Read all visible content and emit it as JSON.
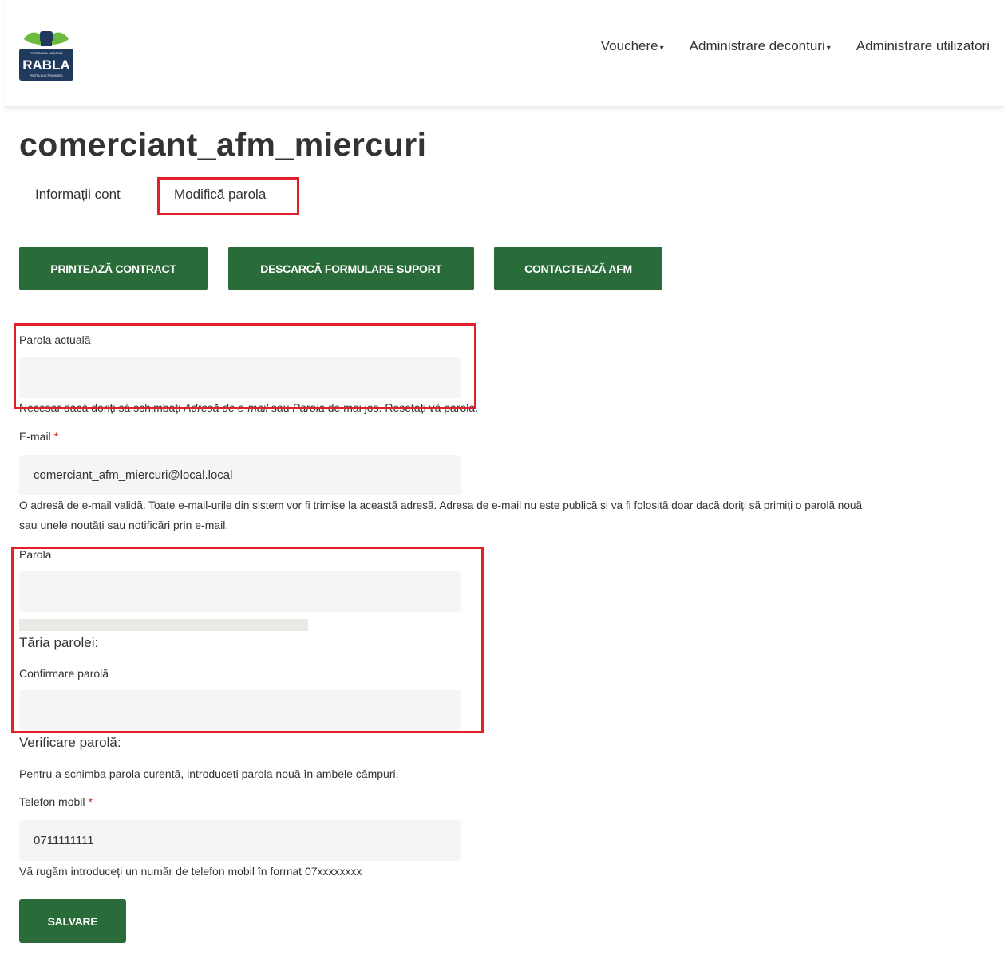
{
  "header": {
    "logo": {
      "icon": "rabla-program-logo",
      "text": "RABLA",
      "small_top": "PROGRAMUL NAȚIONAL",
      "small_bottom": "PENTRU ELECTRIC/HIBRID"
    },
    "nav": [
      {
        "label": "Vouchere",
        "caret": "▾"
      },
      {
        "label": "Administrare deconturi",
        "caret": "▾"
      },
      {
        "label": "Administrare utilizatori",
        "caret": ""
      }
    ]
  },
  "page": {
    "title": "comerciant_afm_miercuri",
    "tabs": [
      {
        "label": "Informații cont",
        "active": false
      },
      {
        "label": "Modifică parola",
        "active": true
      }
    ],
    "actions": {
      "print_contract": "PRINTEAZĂ CONTRACT",
      "download_forms": "DESCARCĂ FORMULARE SUPORT",
      "contact_afm": "CONTACTEAZĂ AFM"
    }
  },
  "form": {
    "current_password": {
      "label": "Parola actuală",
      "value": "",
      "help_before": "Necesar dacă doriți să schimbați ",
      "help_em1": "Adresă de e-mail",
      "help_mid": " sau ",
      "help_em2": "Parola",
      "help_after": " de mai jos. ",
      "help_link": "Resetați vă parola."
    },
    "email": {
      "label": "E-mail",
      "required_mark": "*",
      "value": "comerciant_afm_miercuri@local.local",
      "help_line1": "O adresă de e-mail validă. Toate e-mail-urile din sistem vor fi trimise la această adresă. Adresa de e-mail nu este publică și va fi folosită doar dacă doriți să primiți o parolă nouă",
      "help_line2": "sau unele noutăți sau notificări prin e-mail."
    },
    "password": {
      "label": "Parola",
      "value": "",
      "strength_label": "Tăria parolei:",
      "strength_level": 0
    },
    "confirm_password": {
      "label": "Confirmare parolă",
      "value": "",
      "verify_label": "Verificare parolă:",
      "help": "Pentru a schimba parola curentă, introduceți parola nouă în ambele câmpuri."
    },
    "phone": {
      "label": "Telefon mobil",
      "required_mark": "*",
      "value": "0711111111",
      "help": "Vă rugăm introduceți un număr de telefon mobil în format 07xxxxxxxx"
    },
    "save_label": "SALVARE"
  },
  "colors": {
    "primary_green": "#2a6b3a",
    "required_red": "#d41c1c",
    "annotation_red": "#e0202a",
    "input_bg": "#f5f5f5"
  }
}
